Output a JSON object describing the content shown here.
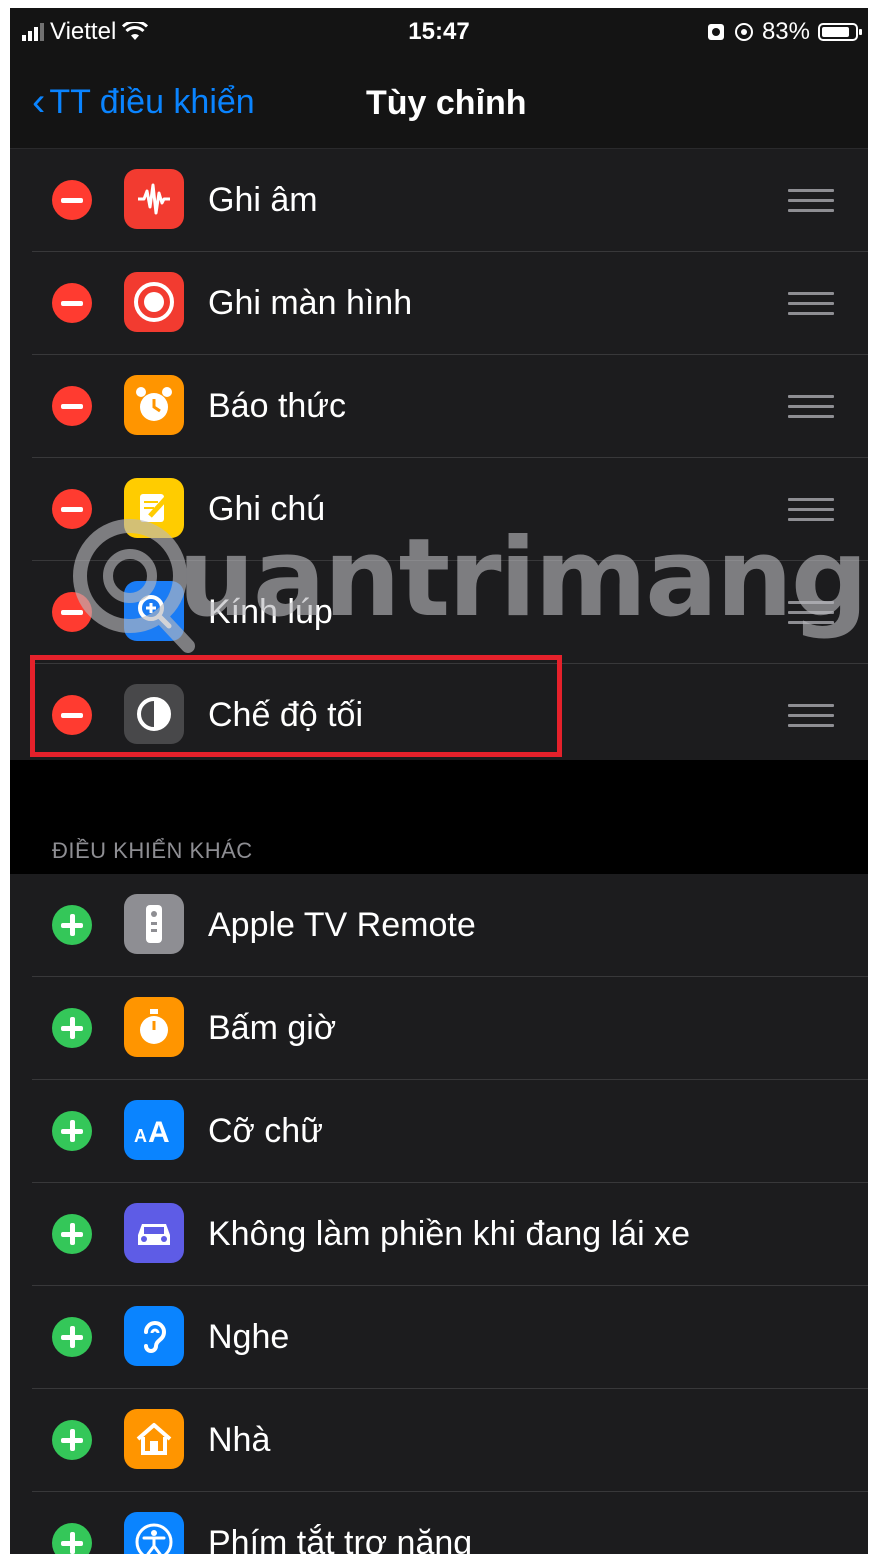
{
  "status_bar": {
    "carrier": "Viettel",
    "time": "15:47",
    "battery": "83%",
    "battery_level": 0.83
  },
  "nav": {
    "back_label": "TT điều khiển",
    "title": "Tùy chỉnh"
  },
  "included": [
    {
      "label": "Ghi âm",
      "icon": "voice-memo-icon",
      "color": "#f23b30"
    },
    {
      "label": "Ghi màn hình",
      "icon": "screen-record-icon",
      "color": "#f23b30"
    },
    {
      "label": "Báo thức",
      "icon": "alarm-icon",
      "color": "#ff9500"
    },
    {
      "label": "Ghi chú",
      "icon": "notes-icon",
      "color": "#ffcc00"
    },
    {
      "label": "Kính lúp",
      "icon": "magnifier-icon",
      "color": "#1a7cf5"
    },
    {
      "label": "Chế độ tối",
      "icon": "dark-mode-icon",
      "color": "#48484a"
    }
  ],
  "section_header": "ĐIỀU KHIỂN KHÁC",
  "more_controls": [
    {
      "label": "Apple TV Remote",
      "icon": "tv-remote-icon",
      "color": "#8e8e93"
    },
    {
      "label": "Bấm giờ",
      "icon": "stopwatch-icon",
      "color": "#ff9500"
    },
    {
      "label": "Cỡ chữ",
      "icon": "text-size-icon",
      "color": "#0a84ff"
    },
    {
      "label": "Không làm phiền khi đang lái xe",
      "icon": "car-icon",
      "color": "#5e5ce6"
    },
    {
      "label": "Nghe",
      "icon": "ear-icon",
      "color": "#0a84ff"
    },
    {
      "label": "Nhà",
      "icon": "home-icon",
      "color": "#ff9500"
    },
    {
      "label": "Phím tắt trợ năng",
      "icon": "accessibility-icon",
      "color": "#0a84ff"
    }
  ],
  "watermark": "uantrimang"
}
